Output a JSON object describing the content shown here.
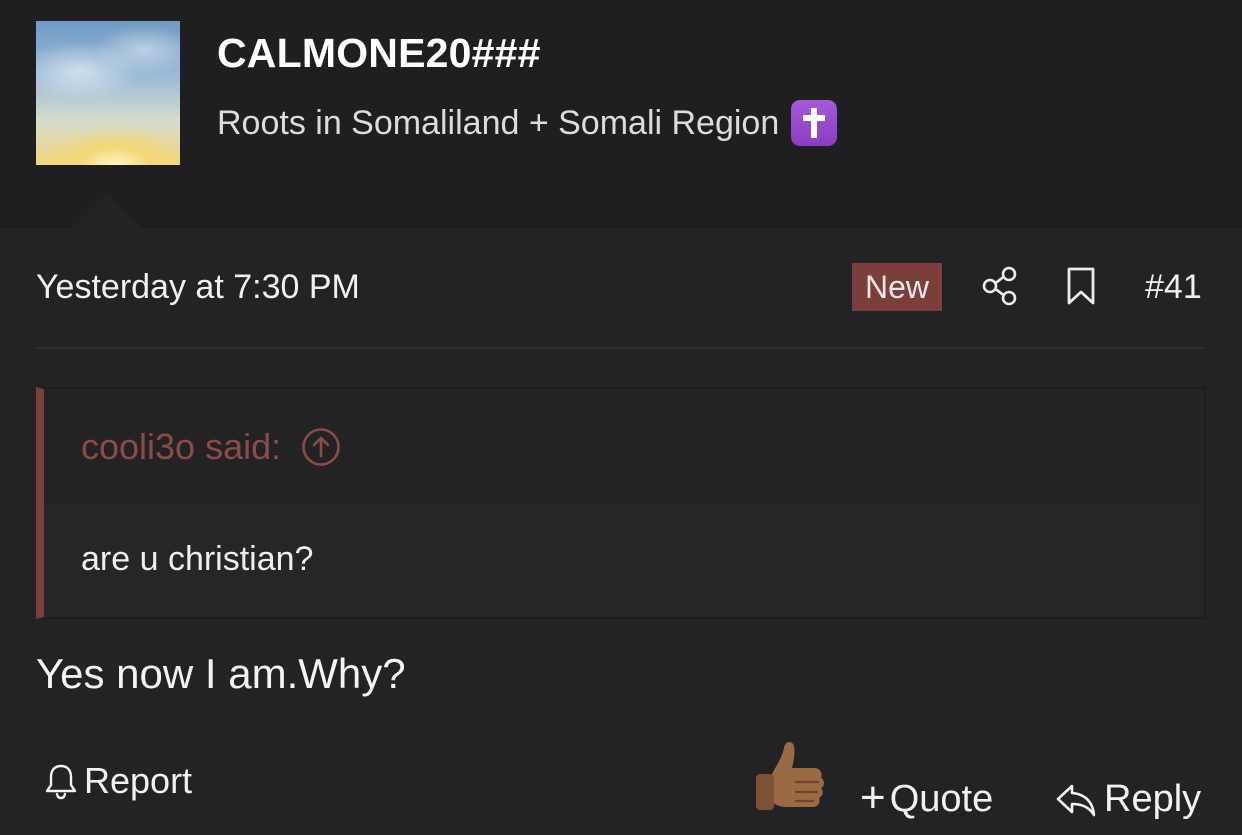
{
  "user": {
    "username": "CALMONE20###",
    "title": "Roots in Somaliland + Somali Region",
    "title_emoji": "latin-cross-emoji"
  },
  "post": {
    "date": "Yesterday at 7:30 PM",
    "badge": "New",
    "number": "#41",
    "text": "Yes now I am.Why?"
  },
  "quote": {
    "author": "cooli3o said:",
    "body": "are u christian?"
  },
  "actions": {
    "report": "Report",
    "quote": "Quote",
    "reply": "Reply",
    "reaction": "thumbs-up-emoji"
  },
  "colors": {
    "background": "#232325",
    "header_background": "#1f1f21",
    "accent": "#7a3f3a",
    "quote_author": "#8a4c47",
    "text": "#ececec"
  }
}
